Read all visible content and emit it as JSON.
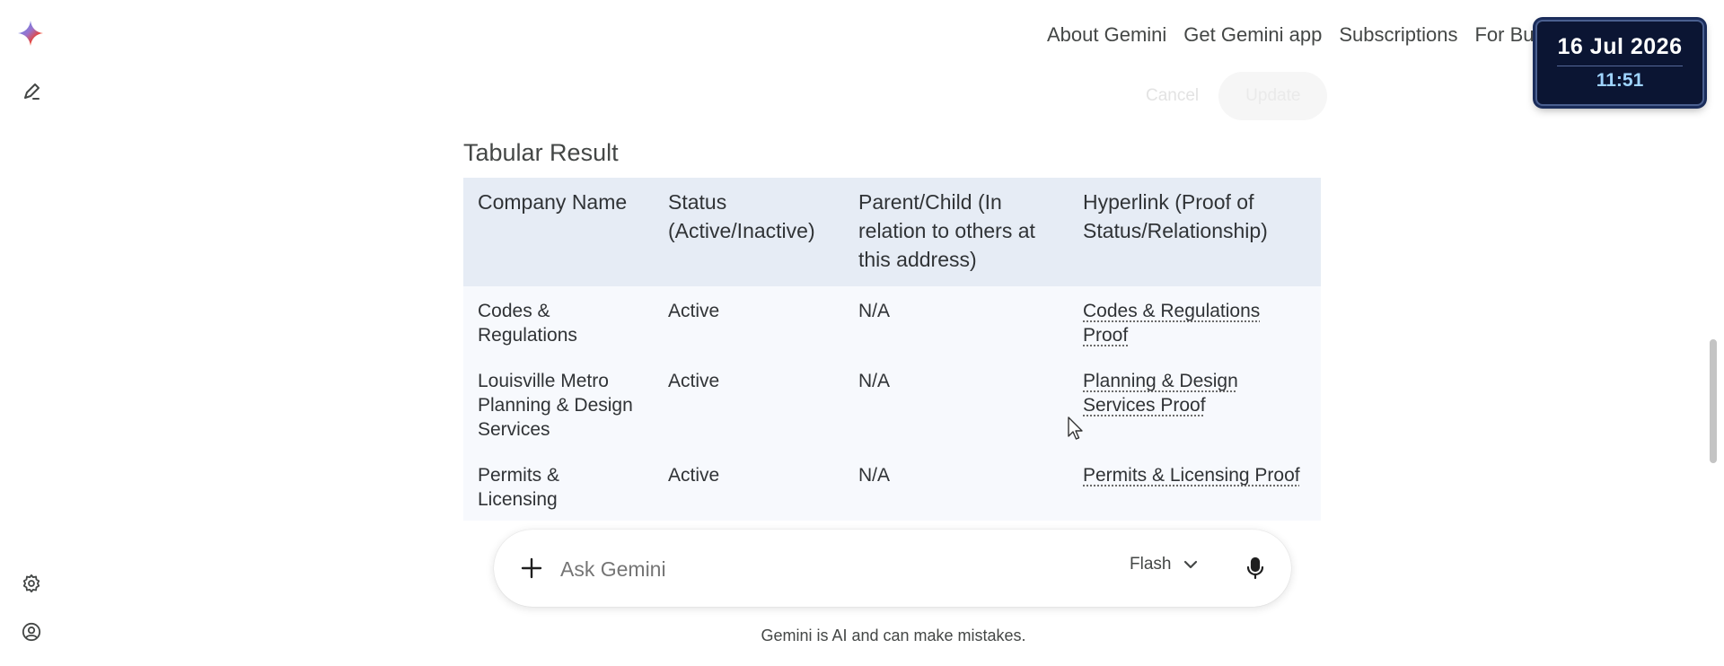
{
  "nav": {
    "items": [
      "About Gemini",
      "Get Gemini app",
      "Subscriptions",
      "For Bu"
    ]
  },
  "clock": {
    "date": "16 Jul 2026",
    "time": "11:51"
  },
  "edit": {
    "cancel": "Cancel",
    "update": "Update"
  },
  "section": {
    "title": "Tabular Result"
  },
  "table": {
    "headers": [
      "Company Name",
      "Status (Active/Inactive)",
      "Parent/Child (In relation to others at this address)",
      "Hyperlink (Proof of Status/Relationship)"
    ],
    "rows": [
      [
        "Codes & Regulations",
        "Active",
        "N/A",
        "Codes & Regulations Proof"
      ],
      [
        "Louisville Metro Planning & Design Services",
        "Active",
        "N/A",
        "Planning & Design Services Proof"
      ],
      [
        "Permits & Licensing",
        "Active",
        "N/A",
        "Permits & Licensing Proof"
      ]
    ]
  },
  "prompt": {
    "placeholder": "Ask Gemini",
    "model": "Flash"
  },
  "footer": {
    "disclaimer": "Gemini is AI and can make mistakes."
  },
  "colors": {
    "header_bg": "#e6ecf5",
    "row_bg": "#f7f9fd",
    "clock_bg": "#0b1533",
    "clock_time": "#9fd4ff"
  },
  "icons": {
    "logo": "gemini-sparkle-icon",
    "new_chat": "edit-icon",
    "settings": "gear-icon",
    "account": "account-icon",
    "add": "plus-icon",
    "dropdown": "chevron-down-icon",
    "mic": "mic-icon"
  }
}
